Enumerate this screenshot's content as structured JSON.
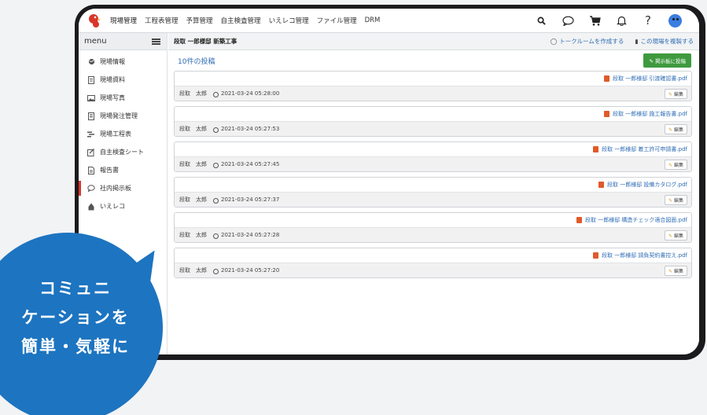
{
  "topbar": {
    "nav": [
      "現場管理",
      "工程表管理",
      "予算管理",
      "自主検査管理",
      "いえレコ管理",
      "ファイル管理",
      "DRM"
    ]
  },
  "sidebar": {
    "title": "menu",
    "items": [
      {
        "label": "現場情報",
        "icon": "globe-icon"
      },
      {
        "label": "現場資料",
        "icon": "document-icon"
      },
      {
        "label": "現場写真",
        "icon": "image-icon"
      },
      {
        "label": "現場発注管理",
        "icon": "list-icon"
      },
      {
        "label": "現場工程表",
        "icon": "gantt-icon"
      },
      {
        "label": "自主検査シート",
        "icon": "checklist-icon"
      },
      {
        "label": "報告書",
        "icon": "report-icon"
      },
      {
        "label": "社内掲示板",
        "icon": "chat-bubble-icon"
      },
      {
        "label": "いえレコ",
        "icon": "house-icon"
      }
    ]
  },
  "main": {
    "breadcrumb": "段取 一郎様邸 新築工事",
    "actions": {
      "create_talk": "トークルームを作成する",
      "copy_site": "この現場を複製する"
    },
    "post_count": "10件の投稿",
    "post_button": "掲示板に投稿",
    "edit_label": "編集",
    "posts": [
      {
        "file": "段取 一郎様邸 引渡確認書.pdf",
        "author": "段取　太郎",
        "time": "2021-03-24 05:28:00"
      },
      {
        "file": "段取 一郎様邸 施工報告書.pdf",
        "author": "段取　太郎",
        "time": "2021-03-24 05:27:53"
      },
      {
        "file": "段取 一郎様邸 着工許可申請書.pdf",
        "author": "段取　太郎",
        "time": "2021-03-24 05:27:45"
      },
      {
        "file": "段取 一郎様邸 設備カタログ.pdf",
        "author": "段取　太郎",
        "time": "2021-03-24 05:27:37"
      },
      {
        "file": "段取 一郎様邸 構造チェック適合図面.pdf",
        "author": "段取　太郎",
        "time": "2021-03-24 05:27:28"
      },
      {
        "file": "段取 一郎様邸 請負契約書控え.pdf",
        "author": "段取　太郎",
        "time": "2021-03-24 05:27:20"
      }
    ]
  },
  "bubble": {
    "lines": [
      "コミュニ",
      "ケーションを",
      "簡単・気軽に"
    ]
  },
  "colors": {
    "accent_blue": "#1d74c0",
    "link_blue": "#2f6db5",
    "active_red": "#d9362b",
    "post_button_green": "#3f9a3f"
  }
}
